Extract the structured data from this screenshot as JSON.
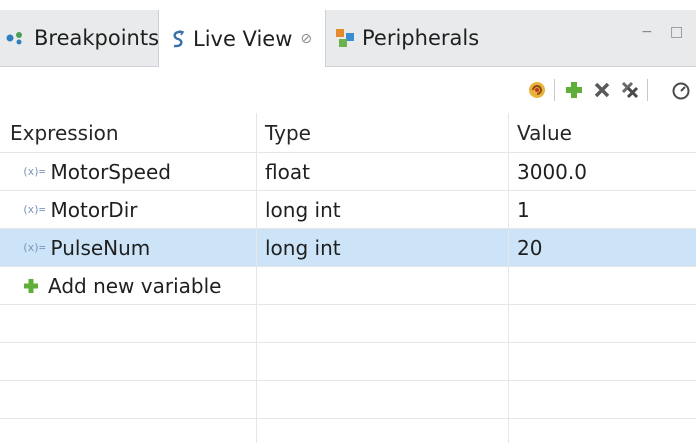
{
  "tabs": [
    {
      "label": "Breakpoints",
      "icon": "breakpoints-icon"
    },
    {
      "label": "Live View",
      "icon": "live-view-icon",
      "active": true,
      "close": "⊘"
    },
    {
      "label": "Peripherals",
      "icon": "peripherals-icon"
    }
  ],
  "window_controls": {
    "minimize": "−",
    "maximize": "□"
  },
  "toolbar": {
    "buttons": [
      "refresh-icon",
      "add-icon",
      "remove-icon",
      "remove-all-icon",
      "gauge-icon"
    ]
  },
  "table": {
    "columns": [
      "Expression",
      "Type",
      "Value"
    ],
    "rows": [
      {
        "expression": "MotorSpeed",
        "type": "float",
        "value": "3000.0",
        "icon": "(x)="
      },
      {
        "expression": "MotorDir",
        "type": "long int",
        "value": "1",
        "icon": "(x)="
      },
      {
        "expression": "PulseNum",
        "type": "long int",
        "value": "20",
        "icon": "(x)=",
        "selected": true
      }
    ],
    "add_row": {
      "label": "Add new variable"
    }
  },
  "colors": {
    "selected_row": "#cde3f7",
    "tab_bar": "#e9eaeb",
    "add_green": "#5fae3a"
  }
}
